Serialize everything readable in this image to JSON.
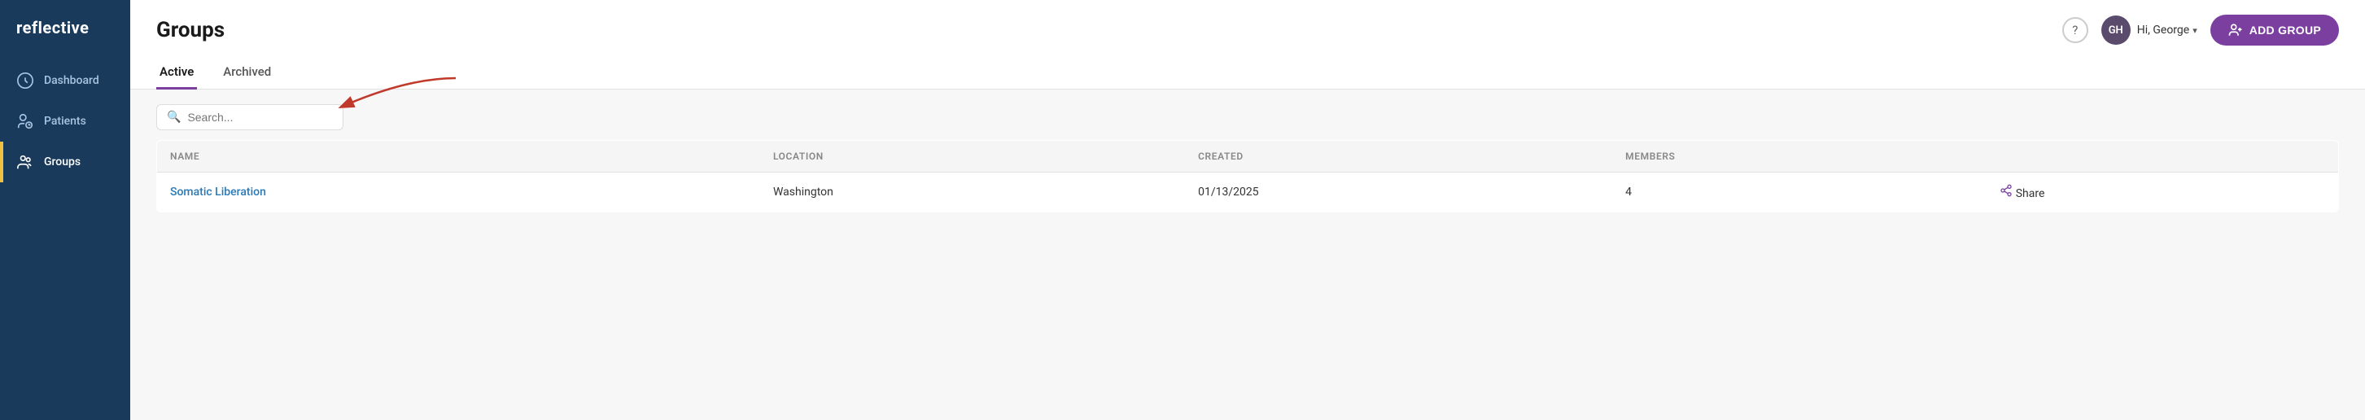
{
  "sidebar": {
    "logo": "reflective",
    "items": [
      {
        "id": "dashboard",
        "label": "Dashboard",
        "active": false
      },
      {
        "id": "patients",
        "label": "Patients",
        "active": false
      },
      {
        "id": "groups",
        "label": "Groups",
        "active": true
      }
    ]
  },
  "header": {
    "title": "Groups",
    "help_icon": "?",
    "user_initials": "GH",
    "user_greeting": "Hi, George",
    "add_group_label": "ADD GROUP"
  },
  "tabs": [
    {
      "id": "active",
      "label": "Active",
      "active": true
    },
    {
      "id": "archived",
      "label": "Archived",
      "active": false
    }
  ],
  "search": {
    "placeholder": "Search..."
  },
  "table": {
    "columns": [
      "NAME",
      "LOCATION",
      "CREATED",
      "MEMBERS",
      ""
    ],
    "rows": [
      {
        "name": "Somatic Liberation",
        "location": "Washington",
        "created": "01/13/2025",
        "members": "4",
        "share": "Share"
      }
    ]
  }
}
